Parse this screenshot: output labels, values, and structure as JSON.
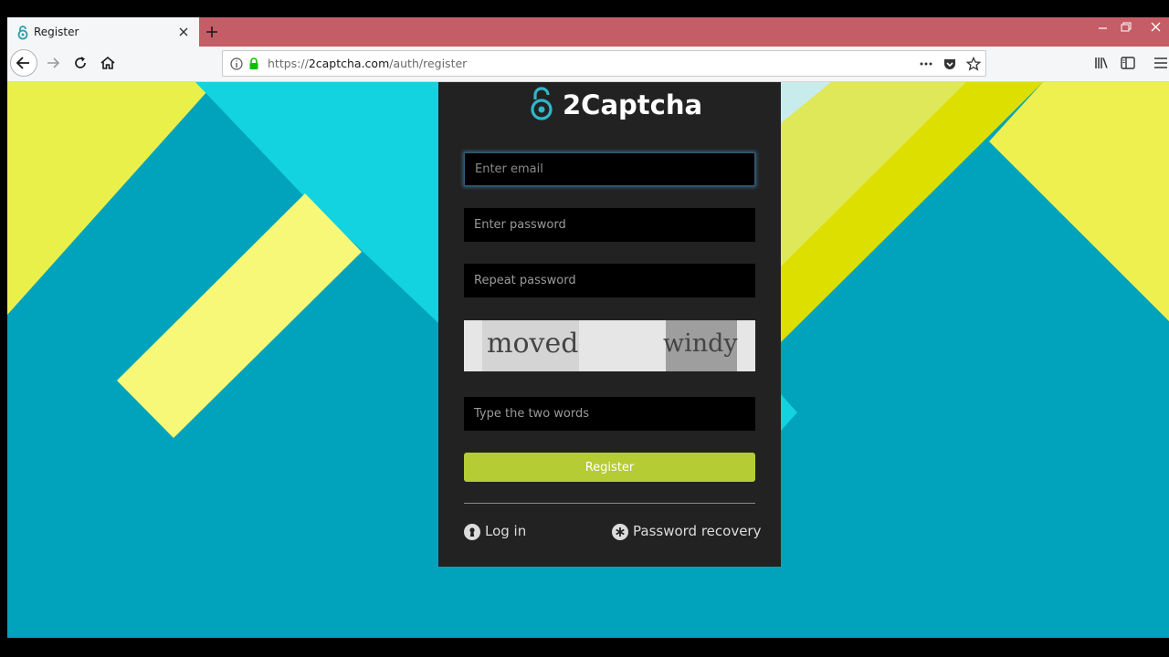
{
  "browser": {
    "tab": {
      "title": "Register",
      "favicon": "2captcha-lock-icon"
    },
    "url": {
      "prefix": "https://",
      "domain": "2captcha.com",
      "path": "/auth/register"
    },
    "toolbar_icons": [
      "back-icon",
      "forward-icon",
      "reload-icon",
      "home-icon",
      "info-icon",
      "lock-icon",
      "more-icon",
      "pocket-icon",
      "bookmark-star-icon",
      "library-icon",
      "sidebar-icon",
      "menu-icon"
    ]
  },
  "page": {
    "logo_text": "2Captcha",
    "form": {
      "email_placeholder": "Enter email",
      "password_placeholder": "Enter password",
      "repeat_placeholder": "Repeat password",
      "captcha_words": [
        "moved",
        "windy"
      ],
      "captcha_placeholder": "Type the two words",
      "submit_label": "Register"
    },
    "footer": {
      "login_label": "Log in",
      "recovery_label": "Password recovery"
    }
  },
  "colors": {
    "accent": "#b5cc34",
    "brand_teal": "#2fb7c9",
    "panel_bg": "#222222",
    "background": "#00a3bb",
    "tab_strip": "#c55d66"
  }
}
